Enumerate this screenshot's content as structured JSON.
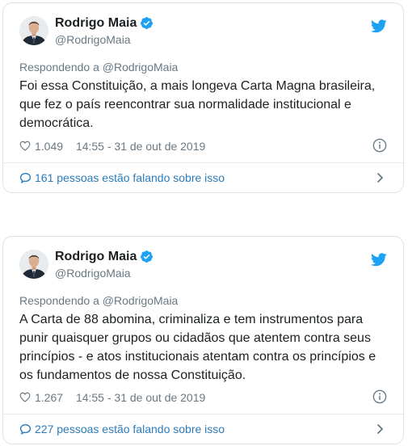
{
  "colors": {
    "accent": "#1da1f2",
    "link": "#2b7bb9",
    "text": "#1c2022",
    "muted": "#697882",
    "border": "#dfe3e6"
  },
  "tweets": [
    {
      "author_name": "Rodrigo Maia",
      "author_handle": "@RodrigoMaia",
      "replying_to": "Respondendo a @RodrigoMaia",
      "text": "Foi essa Constituição, a mais longeva Carta Magna brasileira, que fez o país reencontrar sua normalidade institucional e democrática.",
      "likes": "1.049",
      "timestamp": "14:55 - 31 de out de 2019",
      "conversation": "161 pessoas estão falando sobre isso"
    },
    {
      "author_name": "Rodrigo Maia",
      "author_handle": "@RodrigoMaia",
      "replying_to": "Respondendo a @RodrigoMaia",
      "text": "A Carta de 88 abomina, criminaliza e tem instrumentos para punir quaisquer grupos ou cidadãos que atentem contra seus princípios - e atos institucionais atentam contra os princípios e os fundamentos de nossa Constituição.",
      "likes": "1.267",
      "timestamp": "14:55 - 31 de out de 2019",
      "conversation": "227 pessoas estão falando sobre isso"
    }
  ],
  "icons": {
    "verified": "verified-badge-icon",
    "brand": "twitter-bird-icon",
    "like": "heart-icon",
    "info": "info-icon",
    "reply": "speech-bubble-icon",
    "more": "chevron-right-icon"
  }
}
